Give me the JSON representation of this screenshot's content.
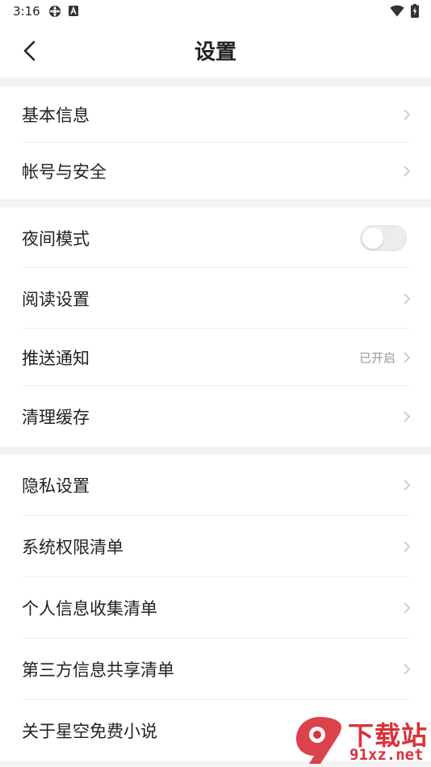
{
  "status_bar": {
    "time": "3:16",
    "icons": [
      "app-notification-icon",
      "a-letter-icon",
      "wifi-icon",
      "battery-charging-icon"
    ]
  },
  "header": {
    "title": "设置",
    "back_icon": "chevron-left-icon"
  },
  "groups": [
    {
      "items": [
        {
          "label": "基本信息",
          "type": "chevron"
        },
        {
          "label": "帐号与安全",
          "type": "chevron"
        }
      ]
    },
    {
      "items": [
        {
          "label": "夜间模式",
          "type": "toggle",
          "on": false
        },
        {
          "label": "阅读设置",
          "type": "chevron"
        },
        {
          "label": "推送通知",
          "type": "chevron",
          "value": "已开启"
        },
        {
          "label": "清理缓存",
          "type": "chevron"
        }
      ]
    },
    {
      "items": [
        {
          "label": "隐私设置",
          "type": "chevron"
        },
        {
          "label": "系统权限清单",
          "type": "chevron"
        },
        {
          "label": "个人信息收集清单",
          "type": "chevron"
        },
        {
          "label": "第三方信息共享清单",
          "type": "chevron"
        },
        {
          "label": "关于星空免费小说",
          "type": "chevron"
        }
      ]
    }
  ],
  "watermark": {
    "title": "下载站",
    "url": "91xz.net",
    "logo_text": "9"
  },
  "colors": {
    "background": "#f3f3f3",
    "card": "#ffffff",
    "text": "#222222",
    "secondary_text": "#999999",
    "chevron": "#c4c4c4",
    "watermark": "#d9323a"
  }
}
